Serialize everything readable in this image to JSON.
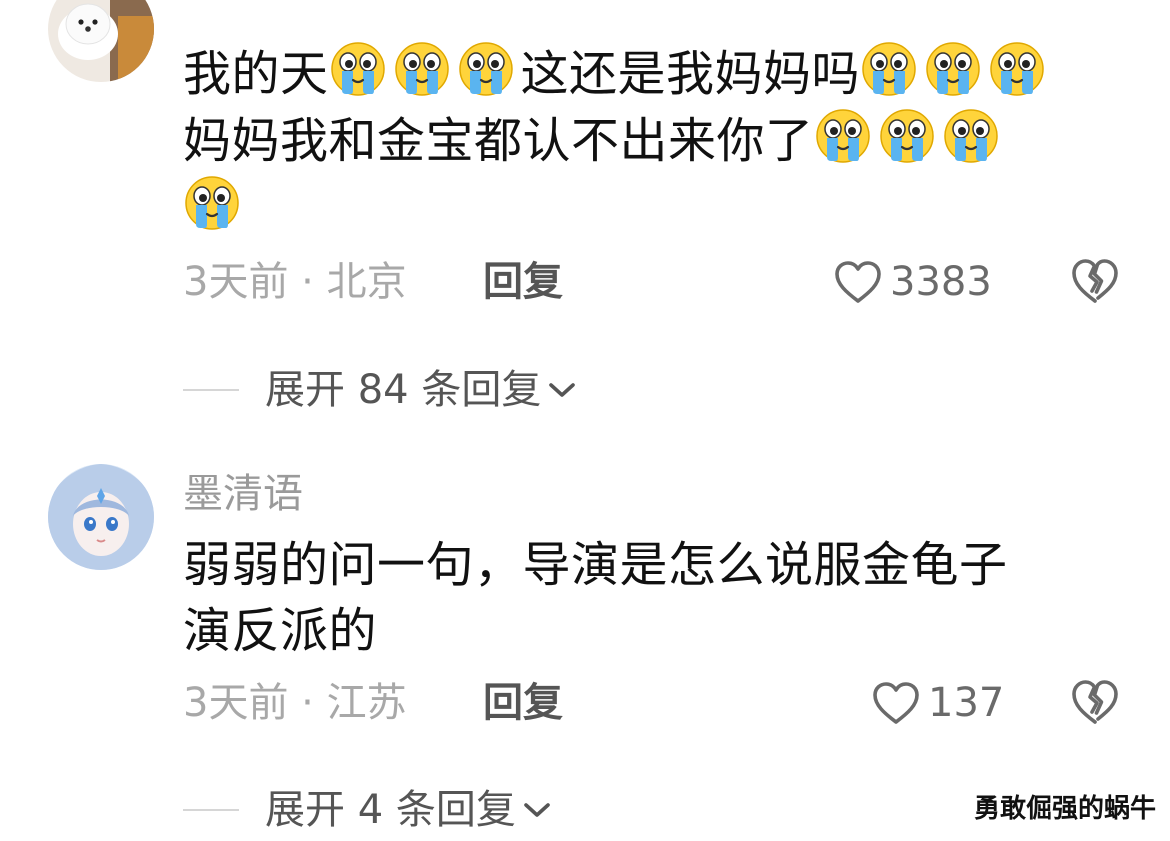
{
  "comments": [
    {
      "avatar": "dog-photo-avatar",
      "body_lines": [
        {
          "segments": [
            {
              "t": "text",
              "v": "我的天"
            },
            {
              "t": "emoji",
              "v": "crying-emoji"
            },
            {
              "t": "emoji",
              "v": "crying-emoji"
            },
            {
              "t": "emoji",
              "v": "crying-emoji"
            },
            {
              "t": "text",
              "v": "这还是我妈妈吗"
            },
            {
              "t": "emoji",
              "v": "crying-emoji"
            },
            {
              "t": "emoji",
              "v": "crying-emoji"
            },
            {
              "t": "emoji",
              "v": "crying-emoji"
            }
          ]
        },
        {
          "segments": [
            {
              "t": "text",
              "v": "妈妈我和金宝都认不出来你了"
            },
            {
              "t": "emoji",
              "v": "crying-emoji"
            },
            {
              "t": "emoji",
              "v": "crying-emoji"
            },
            {
              "t": "emoji",
              "v": "crying-emoji"
            }
          ]
        },
        {
          "segments": [
            {
              "t": "emoji",
              "v": "crying-emoji"
            }
          ]
        }
      ],
      "meta": "3天前 · 北京",
      "reply_label": "回复",
      "likes": "3383",
      "expand_label": "展开 84 条回复"
    },
    {
      "avatar": "anime-girl-avatar",
      "username": "墨清语",
      "body_lines": [
        {
          "segments": [
            {
              "t": "text",
              "v": "弱弱的问一句，导演是怎么说服金龟子"
            }
          ]
        },
        {
          "segments": [
            {
              "t": "text",
              "v": "演反派的"
            }
          ]
        }
      ],
      "meta": "3天前 · 江苏",
      "reply_label": "回复",
      "likes": "137",
      "expand_label": "展开 4 条回复"
    }
  ],
  "watermark": "勇敢倔强的蜗牛",
  "colors": {
    "text": "#111111",
    "meta": "#a8a8a8",
    "secondary": "#555555",
    "divider": "#d6d6d6"
  }
}
